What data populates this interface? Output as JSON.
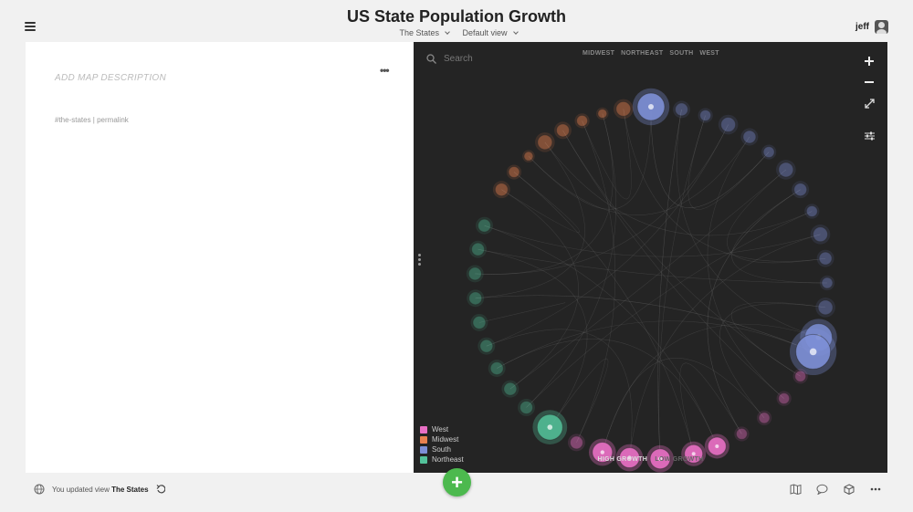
{
  "header": {
    "title": "US State Population Growth",
    "project_label": "The States",
    "view_label": "Default view",
    "username": "jeff"
  },
  "left_panel": {
    "description_placeholder": "ADD MAP DESCRIPTION",
    "more_label": "•••",
    "tag": "#the-states",
    "separator": " | ",
    "permalink": "permalink"
  },
  "map": {
    "search_placeholder": "Search",
    "region_filters": [
      "MIDWEST",
      "NORTHEAST",
      "SOUTH",
      "WEST"
    ],
    "legend": [
      {
        "label": "West",
        "color": "#e86fc4"
      },
      {
        "label": "Midwest",
        "color": "#e8814f"
      },
      {
        "label": "South",
        "color": "#7d8fd6"
      },
      {
        "label": "Northeast",
        "color": "#53c29a"
      }
    ],
    "growth_high": "HIGH GROWTH",
    "growth_low": "LOW GROWTH",
    "controls": [
      "zoom-in-icon",
      "zoom-out-icon",
      "fit-icon",
      "settings-sliders-icon"
    ]
  },
  "footer": {
    "status_prefix": "You updated view",
    "status_view": "The States",
    "add_label": "+"
  },
  "colors": {
    "west": "#e86fc4",
    "midwest": "#e8814f",
    "south": "#7d8fd6",
    "northeast": "#53c29a",
    "add_button": "#4cb94e",
    "map_background": "#242424"
  }
}
